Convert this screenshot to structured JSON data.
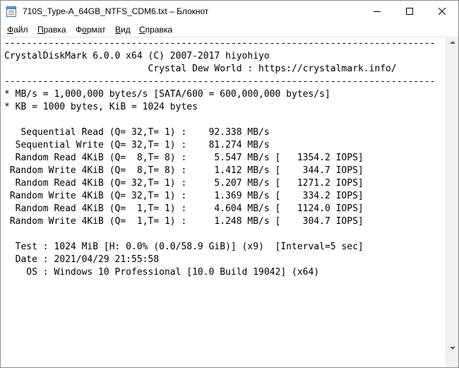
{
  "window": {
    "title": "710S_Type-A_64GB_NTFS_CDM6.txt – Блокнот"
  },
  "menu": {
    "file": {
      "first": "Ф",
      "rest": "айл"
    },
    "edit": {
      "first": "П",
      "rest": "равка"
    },
    "format": {
      "first": "о",
      "rest_before": "Ф",
      "rest_after": "рмат"
    },
    "view": {
      "first": "В",
      "rest": "ид"
    },
    "help": {
      "first": "С",
      "rest": "правка"
    }
  },
  "document": {
    "lines": [
      "------------------------------------------------------------------------------",
      "CrystalDiskMark 6.0.0 x64 (C) 2007-2017 hiyohiyo",
      "                          Crystal Dew World : https://crystalmark.info/",
      "------------------------------------------------------------------------------",
      "* MB/s = 1,000,000 bytes/s [SATA/600 = 600,000,000 bytes/s]",
      "* KB = 1000 bytes, KiB = 1024 bytes",
      "",
      "   Sequential Read (Q= 32,T= 1) :    92.338 MB/s",
      "  Sequential Write (Q= 32,T= 1) :    81.274 MB/s",
      "  Random Read 4KiB (Q=  8,T= 8) :     5.547 MB/s [   1354.2 IOPS]",
      " Random Write 4KiB (Q=  8,T= 8) :     1.412 MB/s [    344.7 IOPS]",
      "  Random Read 4KiB (Q= 32,T= 1) :     5.207 MB/s [   1271.2 IOPS]",
      " Random Write 4KiB (Q= 32,T= 1) :     1.369 MB/s [    334.2 IOPS]",
      "  Random Read 4KiB (Q=  1,T= 1) :     4.604 MB/s [   1124.0 IOPS]",
      " Random Write 4KiB (Q=  1,T= 1) :     1.248 MB/s [    304.7 IOPS]",
      "",
      "  Test : 1024 MiB [H: 0.0% (0.0/58.9 GiB)] (x9)  [Interval=5 sec]",
      "  Date : 2021/04/29 21:55:58",
      "    OS : Windows 10 Professional [10.0 Build 19042] (x64)"
    ]
  },
  "icons": {
    "app": "notepad-icon",
    "minimize": "minimize-icon",
    "maximize": "maximize-icon",
    "close": "close-icon"
  },
  "colors": {
    "text": "#000000",
    "background": "#ffffff",
    "scrollbar": "#f0f0f0"
  }
}
